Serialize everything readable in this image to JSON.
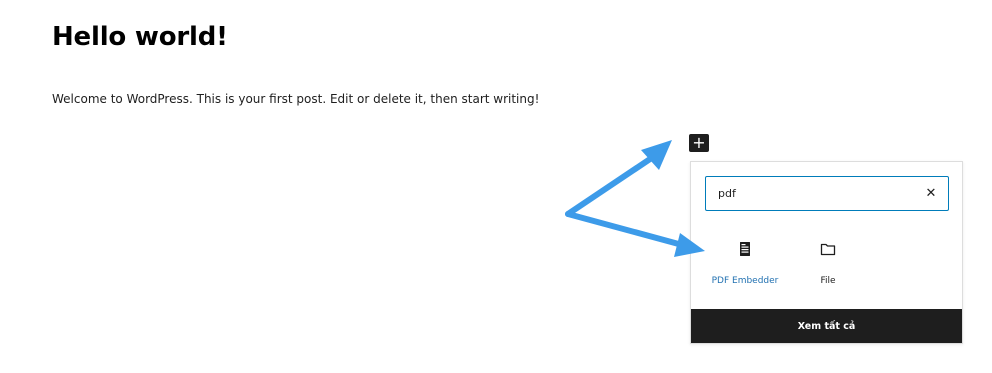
{
  "post": {
    "title": "Hello world!",
    "body": "Welcome to WordPress. This is your first post. Edit or delete it, then start writing!"
  },
  "inserter": {
    "toggle_icon": "plus-icon",
    "toggle_glyph": "+",
    "search": {
      "value": "pdf",
      "clear_glyph": "✕",
      "clear_icon": "close-icon"
    },
    "results": [
      {
        "label": "PDF Embedder",
        "icon": "document-icon"
      },
      {
        "label": "File",
        "icon": "folder-icon"
      }
    ],
    "browse_all_label": "Xem tất cả"
  },
  "colors": {
    "accent": "#007cba",
    "link": "#2271b1",
    "dark": "#1e1e1e",
    "annotation_arrow": "#3d9be9"
  }
}
